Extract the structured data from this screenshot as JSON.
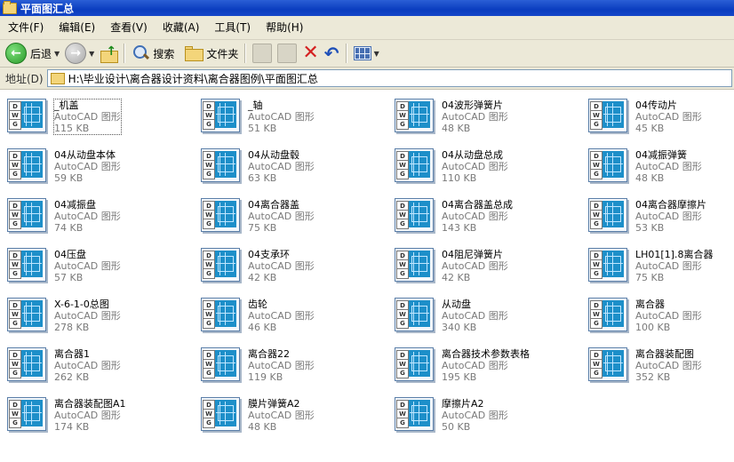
{
  "window": {
    "title": "平面图汇总"
  },
  "menu": [
    "文件(F)",
    "编辑(E)",
    "查看(V)",
    "收藏(A)",
    "工具(T)",
    "帮助(H)"
  ],
  "toolbar": {
    "back_label": "后退",
    "search_label": "搜索",
    "folders_label": "文件夹"
  },
  "address": {
    "label": "地址(D)",
    "path": "H:\\毕业设计\\离合器设计资料\\离合器图例\\平面图汇总"
  },
  "files": [
    {
      "name": "_机盖",
      "type": "AutoCAD 图形",
      "size": "115 KB"
    },
    {
      "name": "_轴",
      "type": "AutoCAD 图形",
      "size": "51 KB"
    },
    {
      "name": "04波形弹簧片",
      "type": "AutoCAD 图形",
      "size": "48 KB"
    },
    {
      "name": "04传动片",
      "type": "AutoCAD 图形",
      "size": "45 KB"
    },
    {
      "name": "04从动盘本体",
      "type": "AutoCAD 图形",
      "size": "59 KB"
    },
    {
      "name": "04从动盘毂",
      "type": "AutoCAD 图形",
      "size": "63 KB"
    },
    {
      "name": "04从动盘总成",
      "type": "AutoCAD 图形",
      "size": "110 KB"
    },
    {
      "name": "04减振弹簧",
      "type": "AutoCAD 图形",
      "size": "48 KB"
    },
    {
      "name": "04减振盘",
      "type": "AutoCAD 图形",
      "size": "74 KB"
    },
    {
      "name": "04离合器盖",
      "type": "AutoCAD 图形",
      "size": "75 KB"
    },
    {
      "name": "04离合器盖总成",
      "type": "AutoCAD 图形",
      "size": "143 KB"
    },
    {
      "name": "04离合器摩擦片",
      "type": "AutoCAD 图形",
      "size": "53 KB"
    },
    {
      "name": "04压盘",
      "type": "AutoCAD 图形",
      "size": "57 KB"
    },
    {
      "name": "04支承环",
      "type": "AutoCAD 图形",
      "size": "42 KB"
    },
    {
      "name": "04阻尼弹簧片",
      "type": "AutoCAD 图形",
      "size": "42 KB"
    },
    {
      "name": "LH01[1].8离合器",
      "type": "AutoCAD 图形",
      "size": "75 KB"
    },
    {
      "name": "X-6-1-0总图",
      "type": "AutoCAD 图形",
      "size": "278 KB"
    },
    {
      "name": "齿轮",
      "type": "AutoCAD 图形",
      "size": "46 KB"
    },
    {
      "name": "从动盘",
      "type": "AutoCAD 图形",
      "size": "340 KB"
    },
    {
      "name": "离合器",
      "type": "AutoCAD 图形",
      "size": "100 KB"
    },
    {
      "name": "离合器1",
      "type": "AutoCAD 图形",
      "size": "262 KB"
    },
    {
      "name": "离合器22",
      "type": "AutoCAD 图形",
      "size": "119 KB"
    },
    {
      "name": "离合器技术参数表格",
      "type": "AutoCAD 图形",
      "size": "195 KB"
    },
    {
      "name": "离合器装配图",
      "type": "AutoCAD 图形",
      "size": "352 KB"
    },
    {
      "name": "离合器装配图A1",
      "type": "AutoCAD 图形",
      "size": "174 KB"
    },
    {
      "name": "膜片弹簧A2",
      "type": "AutoCAD 图形",
      "size": "48 KB"
    },
    {
      "name": "摩擦片A2",
      "type": "AutoCAD 图形",
      "size": "50 KB"
    }
  ]
}
